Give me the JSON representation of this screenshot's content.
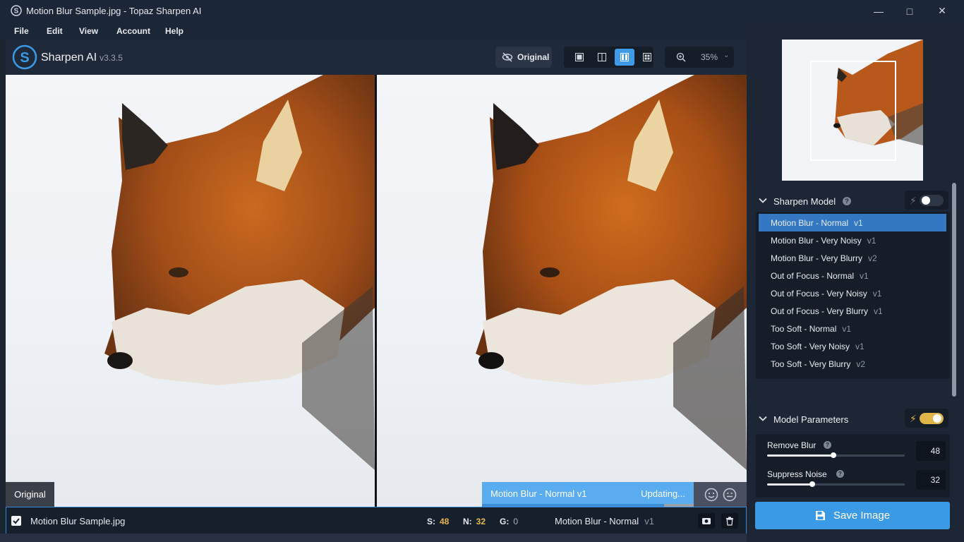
{
  "window": {
    "title": "Motion Blur Sample.jpg - Topaz Sharpen AI",
    "controls": [
      "minimize-icon",
      "maximize-icon",
      "close-icon"
    ]
  },
  "menu": [
    "File",
    "Edit",
    "View",
    "Account",
    "Help"
  ],
  "toolbar": {
    "app_name": "Sharpen AI",
    "version": "v3.3.5",
    "original_button": "Original",
    "view_modes": [
      "single-view-icon",
      "split-view-icon",
      "side-by-side-icon",
      "quad-view-icon"
    ],
    "active_view": 2,
    "zoom": "35%"
  },
  "canvas": {
    "left_tag": "Original",
    "status_model": "Motion Blur - Normal v1",
    "status_text": "Updating...",
    "status_progress": 0.86
  },
  "filebar": {
    "checked": true,
    "filename": "Motion Blur Sample.jpg",
    "s_label": "S:",
    "s_value": "48",
    "n_label": "N:",
    "n_value": "32",
    "g_label": "G:",
    "g_value": "0",
    "model": "Motion Blur - Normal",
    "model_version": "v1"
  },
  "sharpen_model": {
    "title": "Sharpen Model",
    "auto_enabled": false,
    "items": [
      {
        "name": "Motion Blur - Normal",
        "version": "v1",
        "selected": true
      },
      {
        "name": "Motion Blur - Very Noisy",
        "version": "v1"
      },
      {
        "name": "Motion Blur - Very Blurry",
        "version": "v2"
      },
      {
        "name": "Out of Focus - Normal",
        "version": "v1"
      },
      {
        "name": "Out of Focus - Very Noisy",
        "version": "v1"
      },
      {
        "name": "Out of Focus - Very Blurry",
        "version": "v1"
      },
      {
        "name": "Too Soft - Normal",
        "version": "v1"
      },
      {
        "name": "Too Soft - Very Noisy",
        "version": "v1"
      },
      {
        "name": "Too Soft - Very Blurry",
        "version": "v2"
      }
    ]
  },
  "model_parameters": {
    "title": "Model Parameters",
    "auto_enabled": true,
    "params": [
      {
        "label": "Remove Blur",
        "value": "48",
        "fraction": 0.48
      },
      {
        "label": "Suppress Noise",
        "value": "32",
        "fraction": 0.33
      }
    ]
  },
  "save_button": "Save Image",
  "colors": {
    "accent": "#3b9ae6",
    "selected": "#3478c2",
    "stat": "#e9b949",
    "toggle_on": "#e0b446"
  }
}
